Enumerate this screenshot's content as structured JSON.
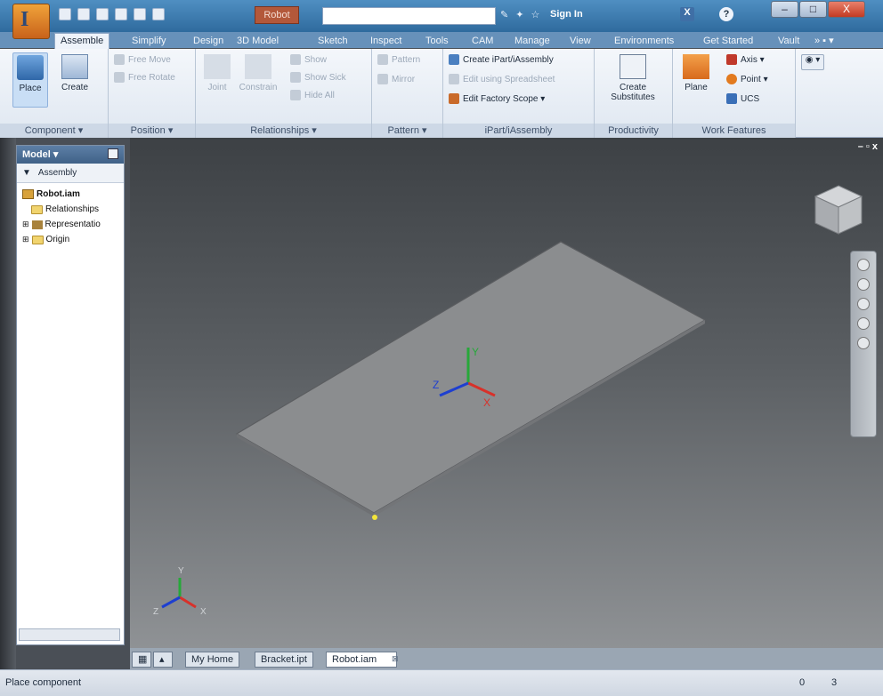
{
  "app": {
    "document_tab_label": "Robot",
    "sign_in_label": "Sign In",
    "help_label": "?"
  },
  "window_buttons": {
    "minimize": "–",
    "maximize": "□",
    "close": "X"
  },
  "tabs": [
    {
      "label": "Assemble",
      "active": true
    },
    {
      "label": "Simplify"
    },
    {
      "label": "Design"
    },
    {
      "label": "3D Model"
    },
    {
      "label": "Sketch"
    },
    {
      "label": "Inspect"
    },
    {
      "label": "Tools"
    },
    {
      "label": "CAM"
    },
    {
      "label": "Manage"
    },
    {
      "label": "View"
    },
    {
      "label": "Environments"
    },
    {
      "label": "Get Started"
    },
    {
      "label": "Vault"
    }
  ],
  "ribbon": {
    "component": {
      "title": "Component ▾",
      "place": "Place",
      "create": "Create"
    },
    "position": {
      "title": "Position ▾",
      "free_move": "Free Move",
      "free_rotate": "Free Rotate"
    },
    "relationships": {
      "title": "Relationships ▾",
      "joint": "Joint",
      "constrain": "Constrain",
      "show": "Show",
      "show_sick": "Show Sick",
      "hide_all": "Hide All"
    },
    "pattern": {
      "title": "Pattern ▾",
      "pattern": "Pattern",
      "mirror": "Mirror"
    },
    "ipart": {
      "title": "iPart/iAssembly",
      "create": "Create iPart/iAssembly",
      "edit_spreadsheet": "Edit using Spreadsheet",
      "edit_factory": "Edit Factory Scope ▾"
    },
    "productivity": {
      "title": "Productivity",
      "create": "Create",
      "substitutes": "Substitutes"
    },
    "work_features": {
      "title": "Work Features",
      "plane": "Plane",
      "axis": "Axis ▾",
      "point": "Point ▾",
      "ucs": "UCS"
    }
  },
  "browser": {
    "title": "Model ▾",
    "filter_label": "Assembly",
    "tree": [
      {
        "label": "Robot.iam",
        "bold": true
      },
      {
        "label": "Relationships"
      },
      {
        "label": "Representatio"
      },
      {
        "label": "Origin"
      }
    ]
  },
  "viewport": {
    "corner_controls": "– ▫ x",
    "axes": {
      "x": "X",
      "y": "Y",
      "z": "Z"
    }
  },
  "doc_tabs": [
    {
      "label": "My Home"
    },
    {
      "label": "Bracket.ipt"
    },
    {
      "label": "Robot.iam",
      "active": true
    }
  ],
  "status": {
    "text": "Place component",
    "count_a": "0",
    "count_b": "3"
  },
  "colors": {
    "axis_x": "#d8312a",
    "axis_y": "#27a83a",
    "axis_z": "#1e3fd0"
  }
}
